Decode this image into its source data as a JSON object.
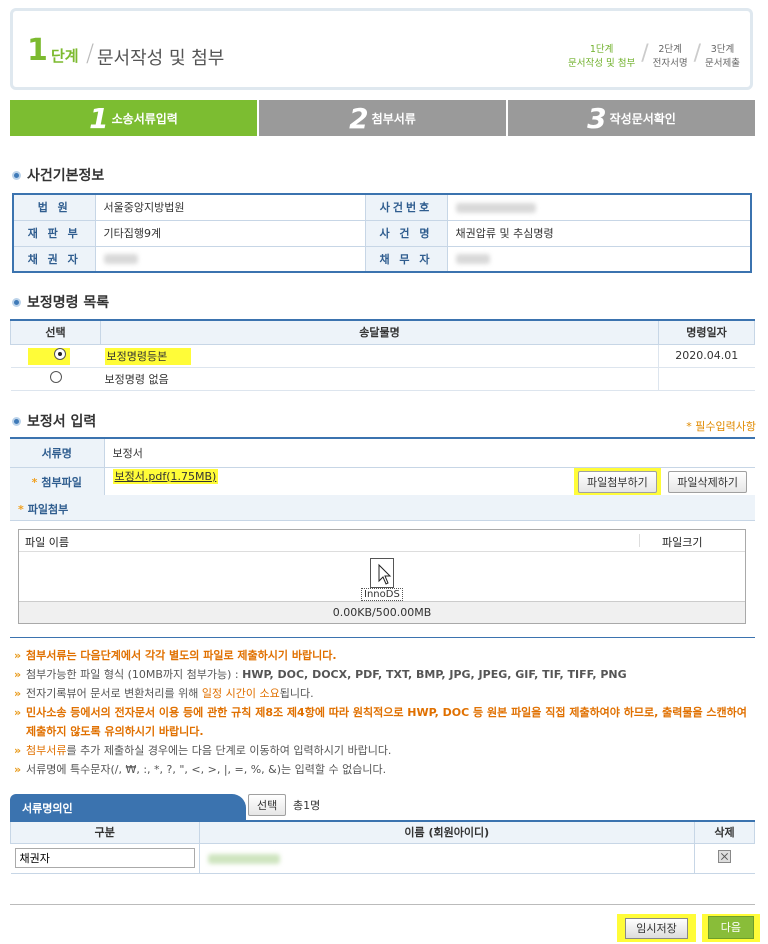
{
  "header": {
    "step_num": "1",
    "step_word": "단계",
    "title": "문서작성 및 첨부",
    "nav": [
      {
        "line1": "1단계",
        "line2": "문서작성 및 첨부",
        "active": true
      },
      {
        "line1": "2단계",
        "line2": "전자서명",
        "active": false
      },
      {
        "line1": "3단계",
        "line2": "문서제출",
        "active": false
      }
    ]
  },
  "tabs": [
    {
      "num": "1",
      "label": "소송서류입력"
    },
    {
      "num": "2",
      "label": "첨부서류"
    },
    {
      "num": "3",
      "label": "작성문서확인"
    }
  ],
  "case_info": {
    "title": "사건기본정보",
    "court_label": "법 원",
    "court_value": "서울중앙지방법원",
    "case_no_label": "사건번호",
    "dept_label": "재 판 부",
    "dept_value": "기타집행9계",
    "case_name_label": "사 건 명",
    "case_name_value": "채권압류 및 추심명령",
    "creditor_label": "채 권 자",
    "debtor_label": "채 무 자"
  },
  "order_list": {
    "title": "보정명령 목록",
    "col_select": "선택",
    "col_name": "송달물명",
    "col_date": "명령일자",
    "rows": [
      {
        "name": "보정명령등본",
        "date": "2020.04.01",
        "selected": true
      },
      {
        "name": "보정명령 없음",
        "date": "",
        "selected": false
      }
    ]
  },
  "input": {
    "title": "보정서 입력",
    "required_note": "* 필수입력사항",
    "doc_name_label": "서류명",
    "doc_name_value": "보정서",
    "attach_label": "첨부파일",
    "attach_value": "보정서.pdf(1.75MB)",
    "attach_btn": "파일첨부하기",
    "delete_btn": "파일삭제하기",
    "file_attach_label": "파일첨부",
    "file_col_name": "파일 이름",
    "file_col_size": "파일크기",
    "drop_label": "InnoDS",
    "capacity": "0.00KB/500.00MB"
  },
  "notes": {
    "n1": "첨부서류는 다음단계에서 각각 별도의 파일로 제출하시기 바랍니다.",
    "n2_prefix": "첨부가능한 파일 형식 (10MB까지 첨부가능) : ",
    "n2_formats": "HWP, DOC, DOCX, PDF, TXT, BMP, JPG, JPEG, GIF, TIF, TIFF, PNG",
    "n3_a": "전자기록뷰어 문서로 변환처리를 위해 ",
    "n3_b": "일정 시간이 소요",
    "n3_c": "됩니다.",
    "n4": "민사소송 등에서의 전자문서 이용 등에 관한 규칙 제8조 제4항에 따라 원칙적으로 HWP, DOC 등 원본 파일을 직접 제출하여야 하므로, 출력물을 스캔하여 제출하지 않도록 유의하시기 바랍니다.",
    "n5_a": "첨부서류",
    "n5_b": "를 추가 제출하실 경우에는 다음 단계로 이동하여 입력하시기 바랍니다.",
    "n6": "서류명에 특수문자(/, ₩, :, *, ?, \", <, >, |, =, %, &)는 입력할 수 없습니다."
  },
  "signer": {
    "tab_label": "서류명의인",
    "select_btn": "선택",
    "count": "총1명",
    "col_type": "구분",
    "col_name": "이름 (회원아이디)",
    "col_del": "삭제",
    "role_value": "채권자"
  },
  "footer": {
    "save_btn": "임시저장",
    "next_btn": "다음"
  },
  "colors": {
    "accent_green": "#7cbd31",
    "accent_blue": "#3b73af",
    "highlight": "#fffc38",
    "orange": "#e07000"
  }
}
